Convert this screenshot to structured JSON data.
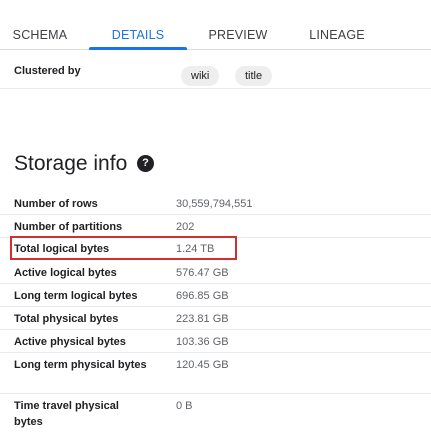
{
  "tabs": [
    {
      "label": "SCHEMA",
      "active": false
    },
    {
      "label": "DETAILS",
      "active": true
    },
    {
      "label": "PREVIEW",
      "active": false
    },
    {
      "label": "LINEAGE",
      "active": false
    }
  ],
  "clustered_by": {
    "label": "Clustered by",
    "chips": [
      "wiki",
      "title"
    ]
  },
  "storage_info": {
    "title": "Storage info",
    "help_icon": "help-circle-icon",
    "rows": [
      {
        "label": "Number of rows",
        "value": "30,559,794,551"
      },
      {
        "label": "Number of partitions",
        "value": "202"
      },
      {
        "label": "Total logical bytes",
        "value": "1.24 TB",
        "highlighted": true
      },
      {
        "label": "Active logical bytes",
        "value": "576.47 GB"
      },
      {
        "label": "Long term logical bytes",
        "value": "696.85 GB"
      },
      {
        "label": "Total physical bytes",
        "value": "223.81 GB"
      },
      {
        "label": "Active physical bytes",
        "value": "103.36 GB"
      },
      {
        "label": "Long term physical bytes",
        "value": "120.45 GB"
      },
      {
        "label": "Time travel physical bytes",
        "value": "0 B"
      }
    ]
  },
  "colors": {
    "accent": "#1a73e8",
    "highlight_border": "#d32f2f"
  }
}
